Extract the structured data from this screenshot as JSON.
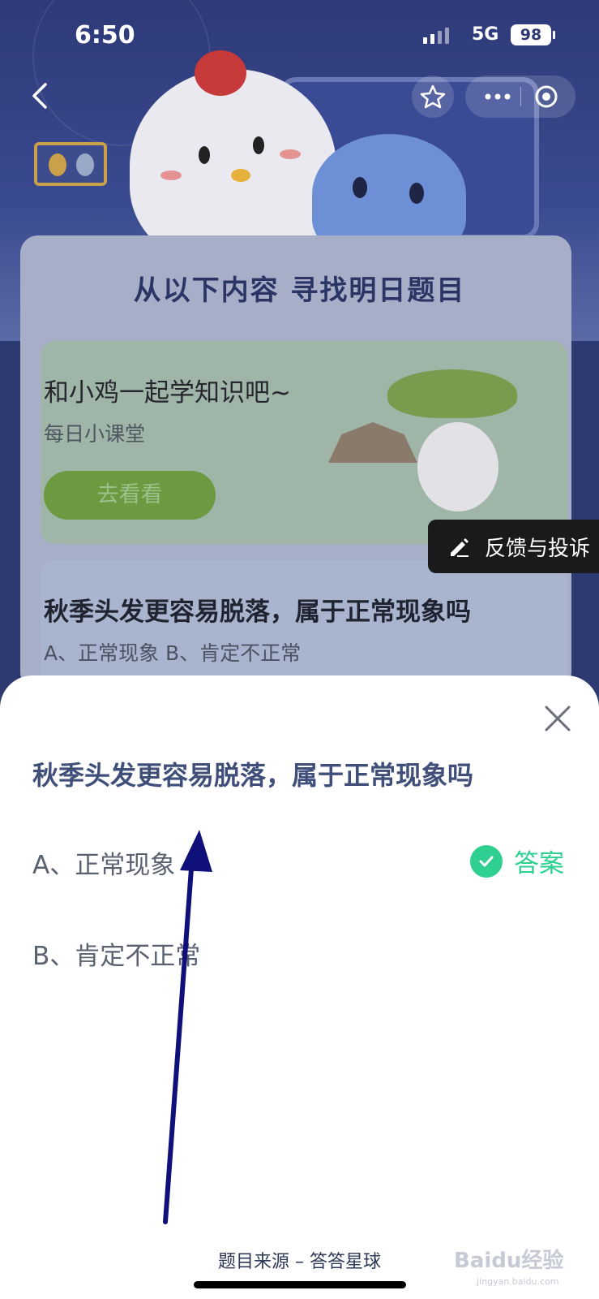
{
  "status_bar": {
    "time": "6:50",
    "network": "5G",
    "battery": "98"
  },
  "background": {
    "section_heading": "从以下内容 寻找明日题目",
    "learn_card": {
      "title": "和小鸡一起学知识吧~",
      "subtitle": "每日小课堂",
      "button": "去看看"
    },
    "question_card": {
      "title": "秋季头发更容易脱落，属于正常现象吗",
      "options": "A、正常现象    B、肯定不正常"
    }
  },
  "feedback": {
    "label": "反馈与投诉"
  },
  "sheet": {
    "question": "秋季头发更容易脱落，属于正常现象吗",
    "options": [
      {
        "label": "A、正常现象",
        "is_answer": true
      },
      {
        "label": "B、肯定不正常",
        "is_answer": false
      }
    ],
    "answer_label": "答案",
    "source": "题目来源 – 答答星球"
  },
  "watermark": {
    "text": "Baidu经验",
    "sub": "jingyan.baidu.com"
  },
  "colors": {
    "accent_green": "#2fcf91",
    "title_blue": "#3f4f7a",
    "header_bg": "#2e3a78",
    "arrow": "#10107a"
  }
}
